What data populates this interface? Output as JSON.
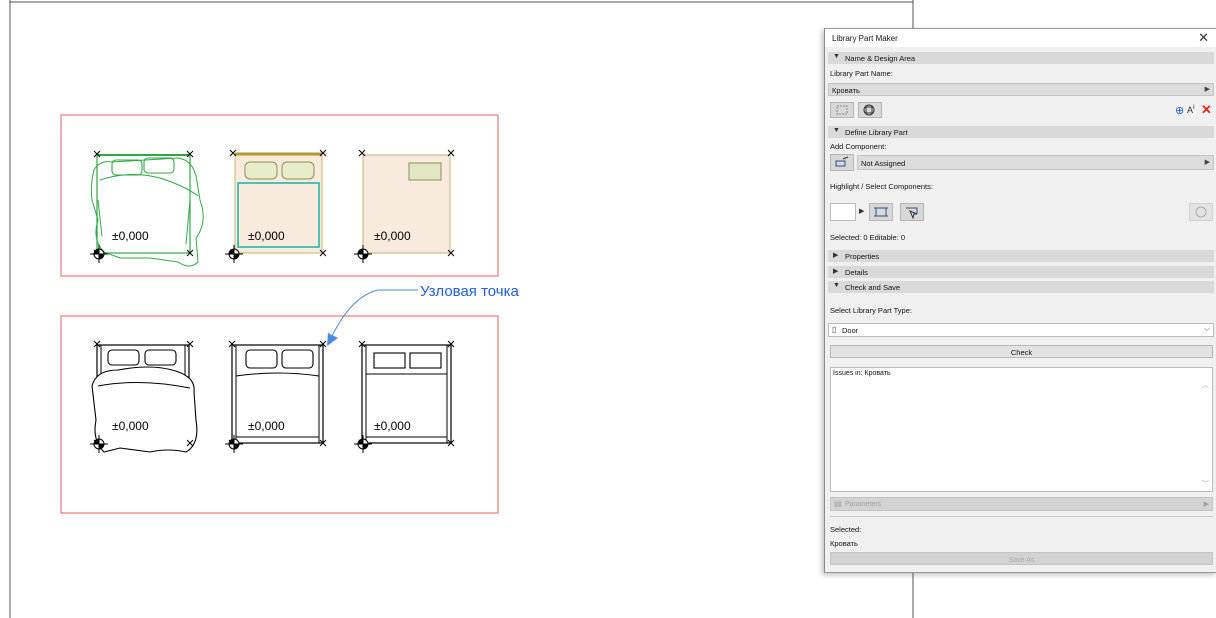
{
  "canvas": {
    "elevation_label": "±0,000",
    "callout_text": "Узловая точка"
  },
  "panel": {
    "title": "Library Part Maker",
    "close_icon": "close-icon",
    "name_design": {
      "header": "Name & Design Area",
      "name_label": "Library Part Name:",
      "name_value": "Кровать"
    },
    "define": {
      "header": "Define Library Part",
      "add_component_label": "Add Component:",
      "component_value": "Not Assigned",
      "highlight_label": "Highlight / Select Components:",
      "selected_editable": "Selected: 0 Editable: 0"
    },
    "properties_header": "Properties",
    "details_header": "Details",
    "check_save": {
      "header": "Check and Save",
      "type_label": "Select Library Part Type:",
      "type_value": "Door",
      "check_button": "Check",
      "issues_text": "Issues in: Кровать"
    },
    "parameters_label": "Parameters",
    "selected_label": "Selected:",
    "selected_value": "Кровать",
    "save_as_button": "Save As"
  },
  "colors": {
    "accent_blue": "#1f5fd8",
    "delete_red": "#e0281a",
    "frame_red": "#e06060",
    "green_outline": "#2fa844",
    "teal_outline": "#22b8a8",
    "fill_peach": "#f8eadd",
    "fill_pillow": "#e8ecc8"
  }
}
